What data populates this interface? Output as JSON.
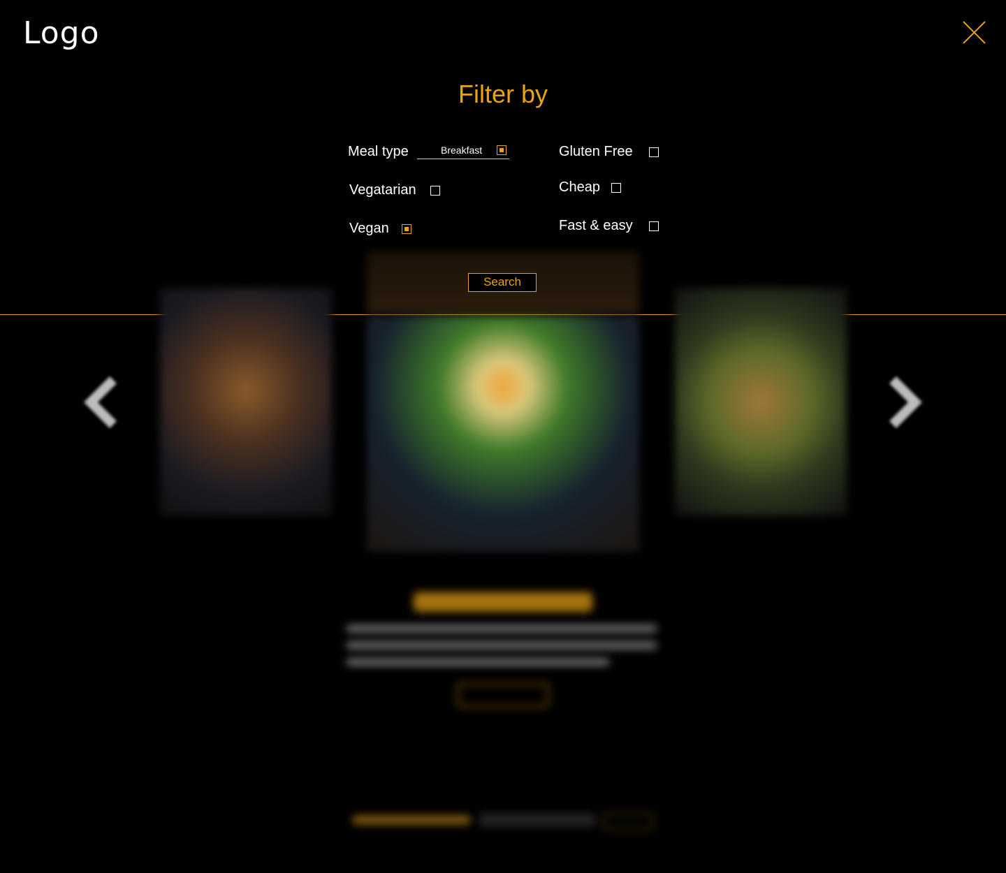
{
  "header": {
    "logo_text": "Logo",
    "close_icon": "close-icon"
  },
  "filter": {
    "title": "Filter by",
    "meal_type": {
      "label": "Meal type",
      "selected": "Breakfast",
      "checked": true
    },
    "options": [
      {
        "label": "Gluten Free",
        "checked": false
      },
      {
        "label": "Vegatarian",
        "checked": false
      },
      {
        "label": "Cheap",
        "checked": false
      },
      {
        "label": "Vegan",
        "checked": true
      },
      {
        "label": "Fast & easy",
        "checked": false
      }
    ],
    "search_label": "Search"
  },
  "carousel": {
    "prev_icon": "chevron-left-icon",
    "next_icon": "chevron-right-icon",
    "images": [
      "waffles-blueberries",
      "egg-spinach-toast",
      "green-salad"
    ]
  },
  "colors": {
    "accent": "#e8a317",
    "background": "#000000",
    "text": "#ffffff"
  }
}
